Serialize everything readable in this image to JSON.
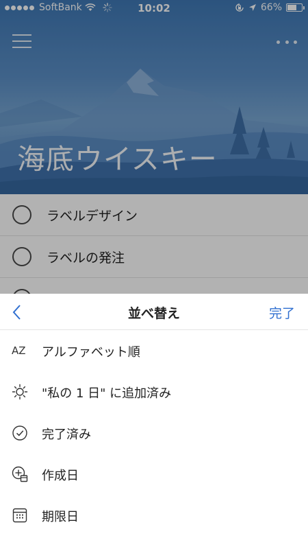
{
  "status_bar": {
    "carrier": "SoftBank",
    "time": "10:02",
    "battery_percent": "66%",
    "battery_level": 0.66,
    "icons": [
      "signal-dots-icon",
      "wifi-icon",
      "activity-spinner-icon",
      "orientation-lock-icon",
      "location-arrow-icon",
      "battery-icon"
    ]
  },
  "header": {
    "menu_icon": "hamburger-menu-icon",
    "more_icon": "more-horizontal-icon"
  },
  "list": {
    "title": "海底ウイスキー",
    "tasks": [
      {
        "label": "ラベルデザイン"
      },
      {
        "label": "ラベルの発注"
      }
    ]
  },
  "sort_sheet": {
    "title": "並べ替え",
    "done_label": "完了",
    "back_icon": "chevron-left-icon",
    "options": [
      {
        "icon": "alphabetical-sort-icon",
        "icon_text": "AZ",
        "label": "アルファベット順"
      },
      {
        "icon": "sun-icon",
        "label": "\"私の 1 日\" に追加済み"
      },
      {
        "icon": "check-circle-icon",
        "label": "完了済み"
      },
      {
        "icon": "add-date-icon",
        "label": "作成日"
      },
      {
        "icon": "calendar-icon",
        "label": "期限日"
      }
    ]
  },
  "colors": {
    "accent": "#2f6fd0",
    "hero_blue": "#3f78b5",
    "overlay": "rgba(0,0,0,0.30)"
  }
}
